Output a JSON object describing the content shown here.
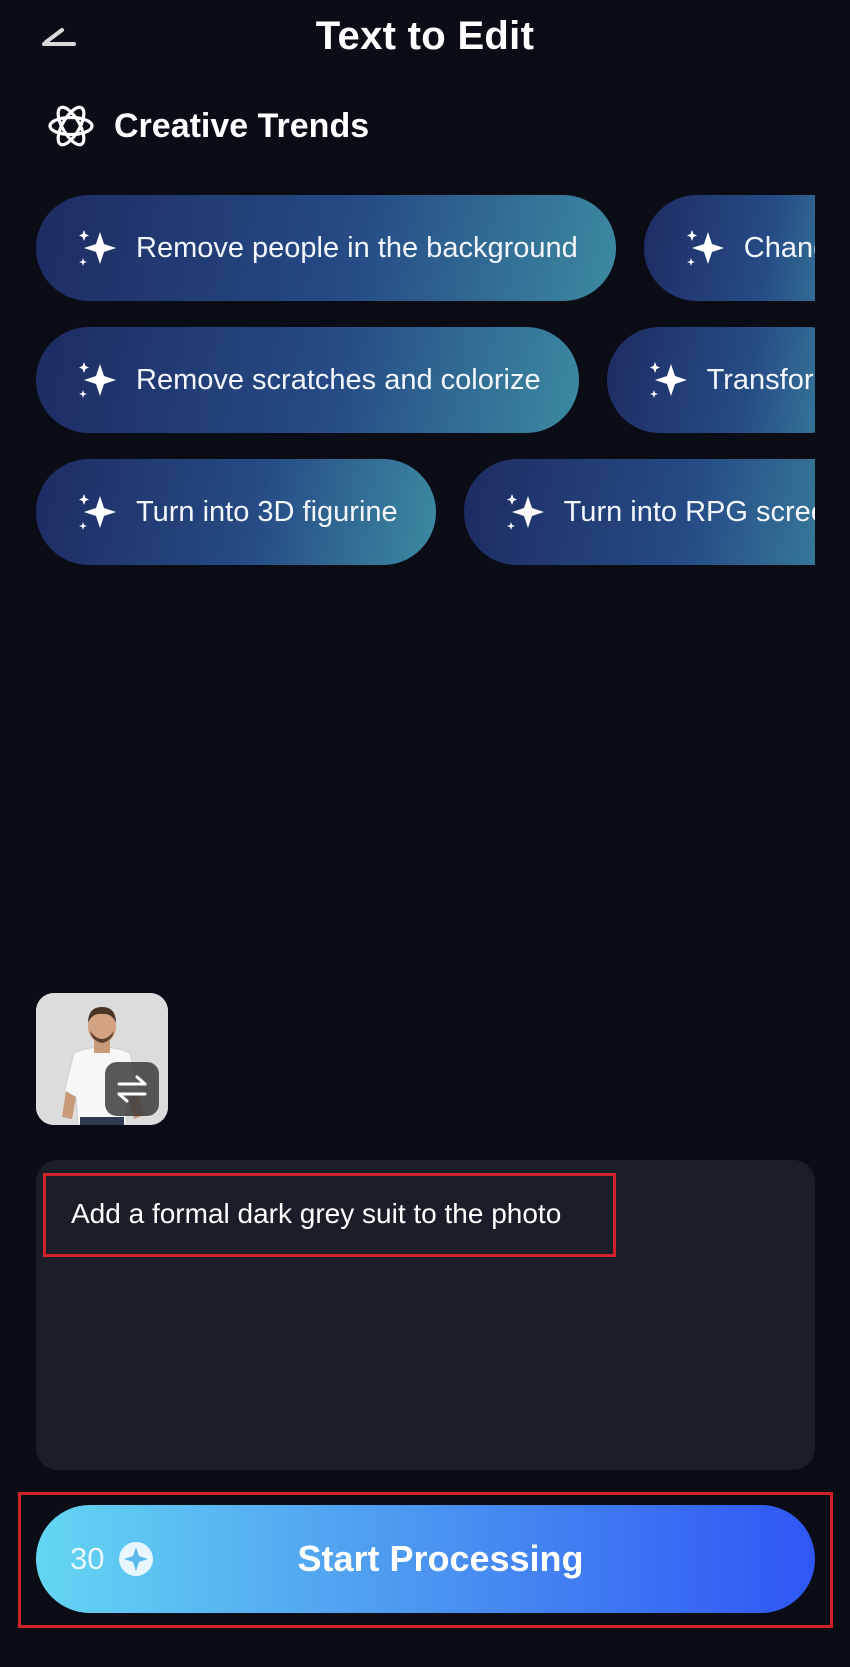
{
  "header": {
    "title": "Text to Edit",
    "back_icon": "back-arrow-icon"
  },
  "section": {
    "title": "Creative Trends",
    "icon": "atom-icon"
  },
  "chip_rows": [
    [
      "Remove people in the background",
      "Chang"
    ],
    [
      "Remove scratches and colorize",
      "Transforr"
    ],
    [
      "Turn into 3D figurine",
      "Turn into RPG screer"
    ]
  ],
  "image": {
    "swap_icon": "swap-arrows-icon"
  },
  "prompt": {
    "text": "Add a formal dark grey suit to the photo"
  },
  "action": {
    "credits": "30",
    "credit_icon": "sparkle-coin-icon",
    "label": "Start Processing"
  },
  "colors": {
    "background": "#0b0d16",
    "chip_gradient_start": "#1e2c63",
    "chip_gradient_end": "#3c8aa1",
    "prompt_background": "#1b1e28",
    "button_gradient_start": "#63d6f3",
    "button_gradient_end": "#2f56f5",
    "highlight": "#d0222b"
  }
}
